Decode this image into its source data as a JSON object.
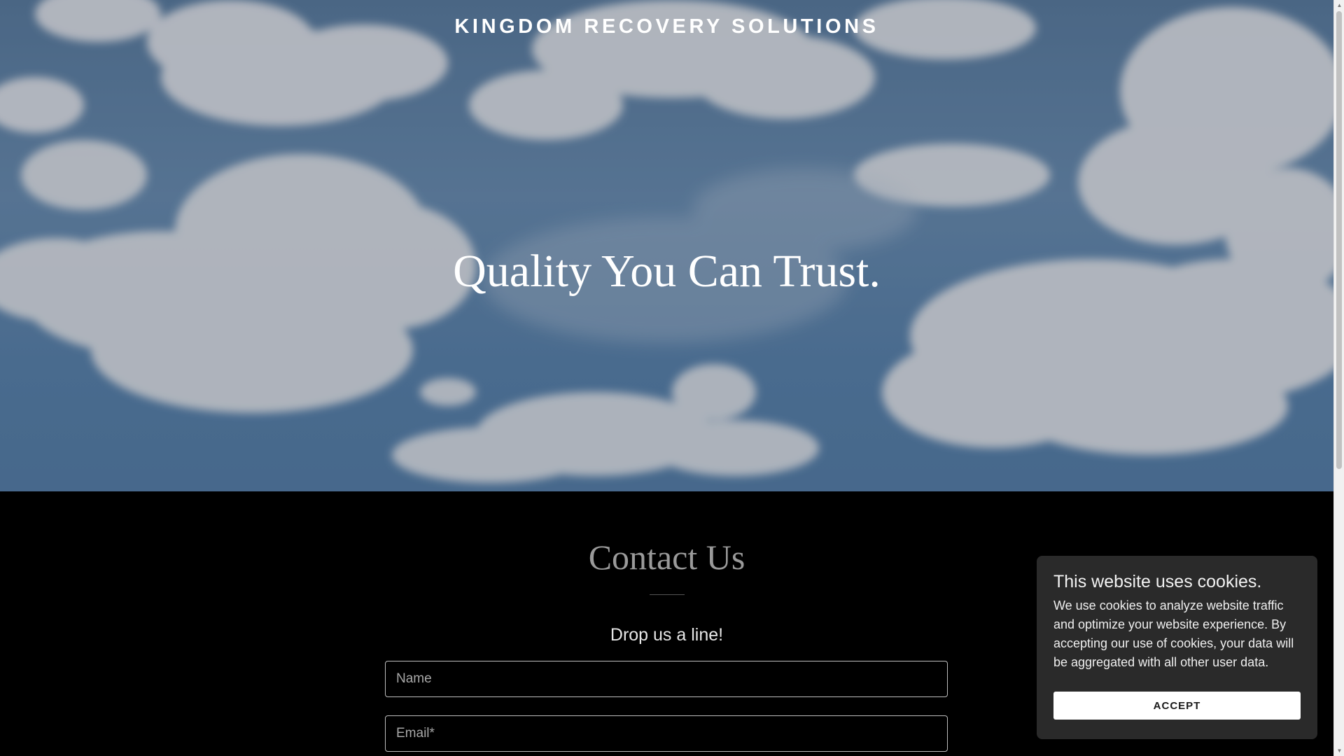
{
  "header": {
    "site_title": "KINGDOM RECOVERY SOLUTIONS"
  },
  "hero": {
    "tagline": "Quality You Can Trust.",
    "background": "sky-with-clouds-image"
  },
  "contact": {
    "heading": "Contact Us",
    "subheading": "Drop us a line!",
    "fields": {
      "name_placeholder": "Name",
      "email_placeholder": "Email*"
    }
  },
  "cookie_banner": {
    "title": "This website uses cookies.",
    "body": "We use cookies to analyze website traffic and optimize your website experience. By accepting our use of cookies, your data will be aggregated with all other user data.",
    "accept_label": "ACCEPT"
  },
  "colors": {
    "page_background": "#000000",
    "cookie_panel": "#2a2a2a",
    "accept_button": "#ffffff"
  },
  "icons": {
    "scroll_up": "scroll-up-arrow-icon",
    "scroll_down": "scroll-down-arrow-icon"
  }
}
